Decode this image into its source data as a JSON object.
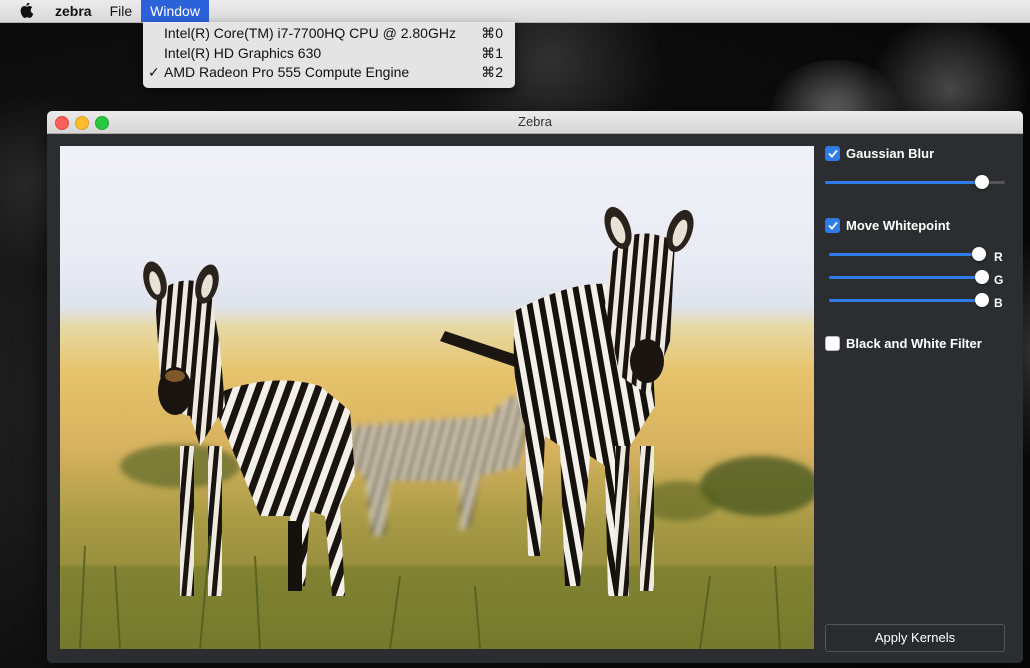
{
  "menubar": {
    "app_name": "zebra",
    "file_label": "File",
    "window_label": "Window"
  },
  "window_menu": {
    "items": [
      {
        "label": "Intel(R) Core(TM) i7-7700HQ CPU @ 2.80GHz",
        "shortcut": "⌘0",
        "checked": false
      },
      {
        "label": "Intel(R) HD Graphics 630",
        "shortcut": "⌘1",
        "checked": false
      },
      {
        "label": "AMD Radeon Pro 555 Compute Engine",
        "shortcut": "⌘2",
        "checked": true
      }
    ],
    "check_glyph": "✓"
  },
  "app_window": {
    "title": "Zebra"
  },
  "controls": {
    "gaussian_blur": {
      "label": "Gaussian Blur",
      "checked": true,
      "value_fraction": 0.87
    },
    "move_whitepoint": {
      "label": "Move Whitepoint",
      "checked": true,
      "r": {
        "label": "R",
        "value_fraction": 0.98
      },
      "g": {
        "label": "G",
        "value_fraction": 1.0
      },
      "b": {
        "label": "B",
        "value_fraction": 1.0
      }
    },
    "bw_filter": {
      "label": "Black and White Filter",
      "checked": false
    },
    "apply_label": "Apply Kernels"
  },
  "colors": {
    "accent": "#2f7ce8",
    "window_bg": "#2c2d31",
    "menu_highlight": "#2b62d9"
  },
  "icons": {
    "apple": "apple-logo-icon",
    "checkbox": "checkmark-icon"
  }
}
